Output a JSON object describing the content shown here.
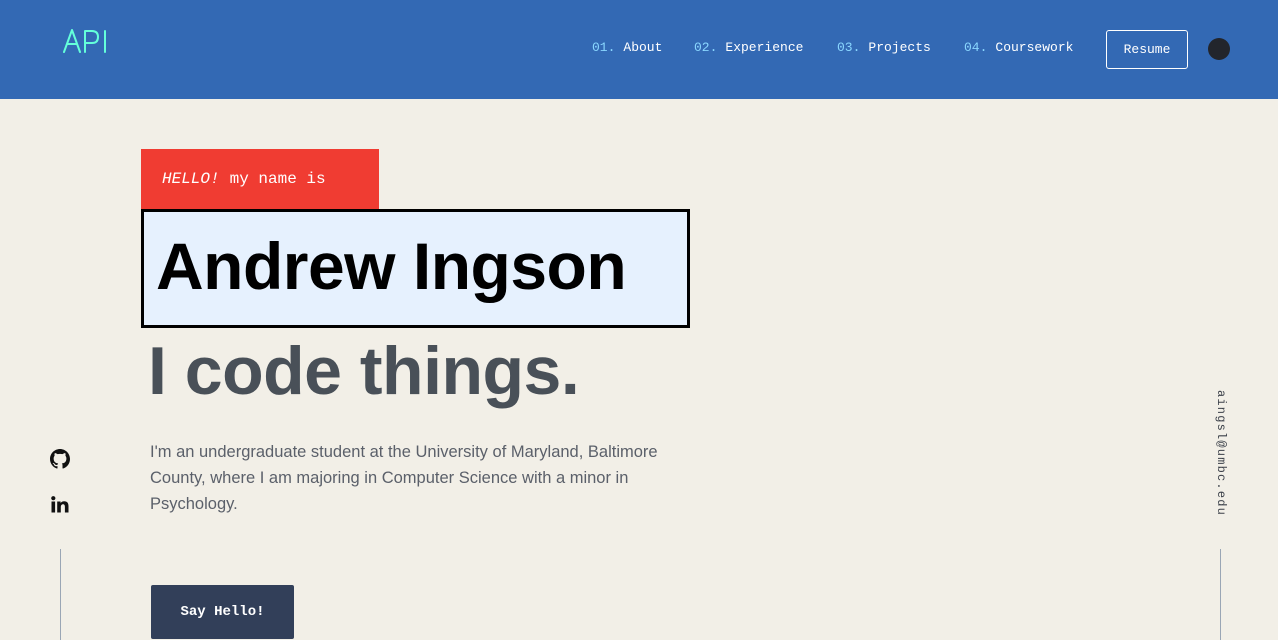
{
  "header": {
    "logo_text": "API",
    "nav": [
      {
        "num": "01.",
        "label": "About"
      },
      {
        "num": "02.",
        "label": "Experience"
      },
      {
        "num": "03.",
        "label": "Projects"
      },
      {
        "num": "04.",
        "label": "Coursework"
      }
    ],
    "resume_label": "Resume",
    "theme_toggle_icon": "moon-toggle-icon"
  },
  "hero": {
    "hello_word": "HELLO!",
    "hello_rest": "my name is",
    "name": "Andrew Ingson",
    "tagline": "I code things.",
    "intro": "I'm an undergraduate student at the University of Maryland, Baltimore County, where I am majoring in Computer Science with a minor in Psychology.",
    "cta_label": "Say Hello!"
  },
  "social": {
    "icons": [
      "github-icon",
      "linkedin-icon"
    ]
  },
  "email": "aingsl@umbc.edu",
  "colors": {
    "header_bg": "#3369b4",
    "page_bg": "#f2efe7",
    "accent_red": "#f03c32",
    "name_box_bg": "#e6f1fe",
    "logo": "#64ffda",
    "cta_bg": "#323f59"
  }
}
